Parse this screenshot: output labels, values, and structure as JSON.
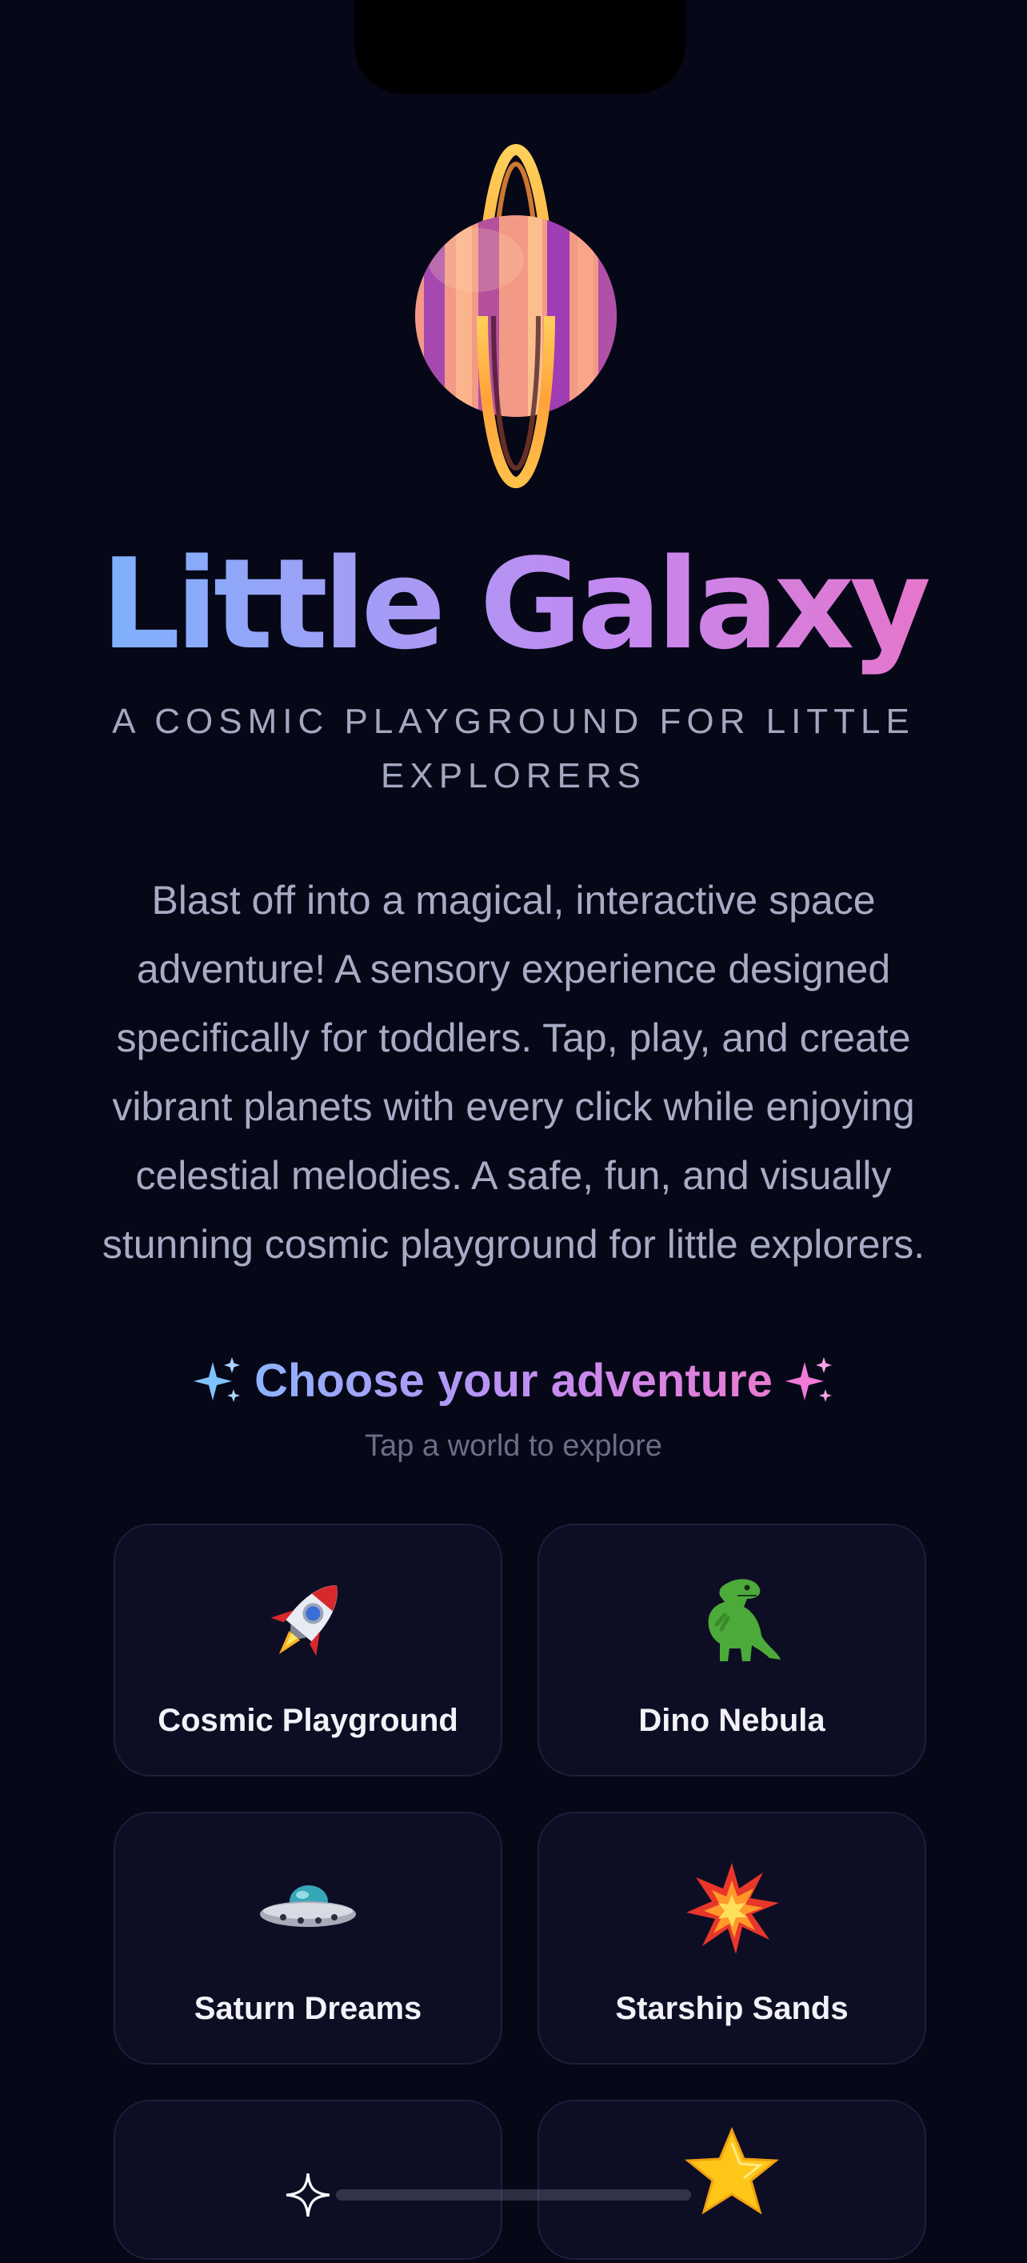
{
  "header": {
    "title": "Little Galaxy",
    "tagline": "A COSMIC PLAYGROUND FOR LITTLE EXPLORERS",
    "description": "Blast off into a magical, interactive space adventure! A sensory experience designed specifically for toddlers. Tap, play, and create vibrant planets with every click while enjoying celestial melodies. A safe, fun, and visually stunning cosmic playground for little explorers."
  },
  "section": {
    "heading": "Choose your adventure",
    "subheading": "Tap a world to explore"
  },
  "worlds": [
    {
      "label": "Cosmic Playground",
      "icon": "rocket-icon"
    },
    {
      "label": "Dino Nebula",
      "icon": "dinosaur-icon"
    },
    {
      "label": "Saturn Dreams",
      "icon": "flying-saucer-icon"
    },
    {
      "label": "Starship Sands",
      "icon": "explosion-icon"
    },
    {
      "label": "",
      "icon": "sparkle-star-icon"
    },
    {
      "label": "",
      "icon": "glowing-star-icon"
    }
  ],
  "colors": {
    "background": "#060817",
    "card": "#0d0e24",
    "title_gradient_start": "#6fb8ff",
    "title_gradient_end": "#f070c0"
  }
}
